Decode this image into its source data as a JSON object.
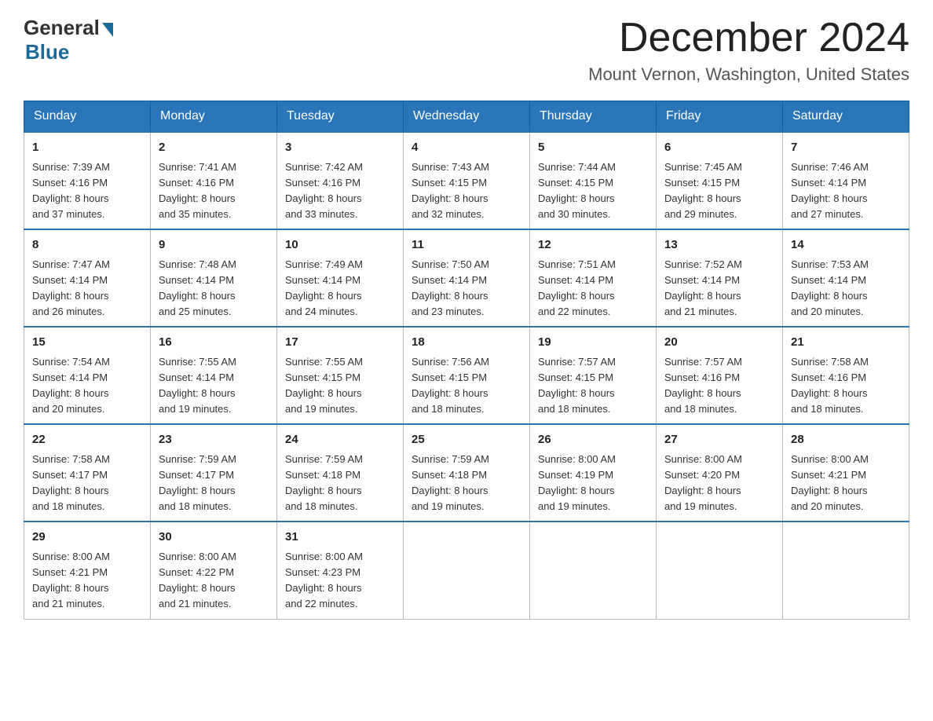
{
  "logo": {
    "general": "General",
    "blue": "Blue"
  },
  "header": {
    "month": "December 2024",
    "location": "Mount Vernon, Washington, United States"
  },
  "weekdays": [
    "Sunday",
    "Monday",
    "Tuesday",
    "Wednesday",
    "Thursday",
    "Friday",
    "Saturday"
  ],
  "weeks": [
    [
      {
        "day": "1",
        "sunrise": "7:39 AM",
        "sunset": "4:16 PM",
        "daylight": "8 hours and 37 minutes."
      },
      {
        "day": "2",
        "sunrise": "7:41 AM",
        "sunset": "4:16 PM",
        "daylight": "8 hours and 35 minutes."
      },
      {
        "day": "3",
        "sunrise": "7:42 AM",
        "sunset": "4:16 PM",
        "daylight": "8 hours and 33 minutes."
      },
      {
        "day": "4",
        "sunrise": "7:43 AM",
        "sunset": "4:15 PM",
        "daylight": "8 hours and 32 minutes."
      },
      {
        "day": "5",
        "sunrise": "7:44 AM",
        "sunset": "4:15 PM",
        "daylight": "8 hours and 30 minutes."
      },
      {
        "day": "6",
        "sunrise": "7:45 AM",
        "sunset": "4:15 PM",
        "daylight": "8 hours and 29 minutes."
      },
      {
        "day": "7",
        "sunrise": "7:46 AM",
        "sunset": "4:14 PM",
        "daylight": "8 hours and 27 minutes."
      }
    ],
    [
      {
        "day": "8",
        "sunrise": "7:47 AM",
        "sunset": "4:14 PM",
        "daylight": "8 hours and 26 minutes."
      },
      {
        "day": "9",
        "sunrise": "7:48 AM",
        "sunset": "4:14 PM",
        "daylight": "8 hours and 25 minutes."
      },
      {
        "day": "10",
        "sunrise": "7:49 AM",
        "sunset": "4:14 PM",
        "daylight": "8 hours and 24 minutes."
      },
      {
        "day": "11",
        "sunrise": "7:50 AM",
        "sunset": "4:14 PM",
        "daylight": "8 hours and 23 minutes."
      },
      {
        "day": "12",
        "sunrise": "7:51 AM",
        "sunset": "4:14 PM",
        "daylight": "8 hours and 22 minutes."
      },
      {
        "day": "13",
        "sunrise": "7:52 AM",
        "sunset": "4:14 PM",
        "daylight": "8 hours and 21 minutes."
      },
      {
        "day": "14",
        "sunrise": "7:53 AM",
        "sunset": "4:14 PM",
        "daylight": "8 hours and 20 minutes."
      }
    ],
    [
      {
        "day": "15",
        "sunrise": "7:54 AM",
        "sunset": "4:14 PM",
        "daylight": "8 hours and 20 minutes."
      },
      {
        "day": "16",
        "sunrise": "7:55 AM",
        "sunset": "4:14 PM",
        "daylight": "8 hours and 19 minutes."
      },
      {
        "day": "17",
        "sunrise": "7:55 AM",
        "sunset": "4:15 PM",
        "daylight": "8 hours and 19 minutes."
      },
      {
        "day": "18",
        "sunrise": "7:56 AM",
        "sunset": "4:15 PM",
        "daylight": "8 hours and 18 minutes."
      },
      {
        "day": "19",
        "sunrise": "7:57 AM",
        "sunset": "4:15 PM",
        "daylight": "8 hours and 18 minutes."
      },
      {
        "day": "20",
        "sunrise": "7:57 AM",
        "sunset": "4:16 PM",
        "daylight": "8 hours and 18 minutes."
      },
      {
        "day": "21",
        "sunrise": "7:58 AM",
        "sunset": "4:16 PM",
        "daylight": "8 hours and 18 minutes."
      }
    ],
    [
      {
        "day": "22",
        "sunrise": "7:58 AM",
        "sunset": "4:17 PM",
        "daylight": "8 hours and 18 minutes."
      },
      {
        "day": "23",
        "sunrise": "7:59 AM",
        "sunset": "4:17 PM",
        "daylight": "8 hours and 18 minutes."
      },
      {
        "day": "24",
        "sunrise": "7:59 AM",
        "sunset": "4:18 PM",
        "daylight": "8 hours and 18 minutes."
      },
      {
        "day": "25",
        "sunrise": "7:59 AM",
        "sunset": "4:18 PM",
        "daylight": "8 hours and 19 minutes."
      },
      {
        "day": "26",
        "sunrise": "8:00 AM",
        "sunset": "4:19 PM",
        "daylight": "8 hours and 19 minutes."
      },
      {
        "day": "27",
        "sunrise": "8:00 AM",
        "sunset": "4:20 PM",
        "daylight": "8 hours and 19 minutes."
      },
      {
        "day": "28",
        "sunrise": "8:00 AM",
        "sunset": "4:21 PM",
        "daylight": "8 hours and 20 minutes."
      }
    ],
    [
      {
        "day": "29",
        "sunrise": "8:00 AM",
        "sunset": "4:21 PM",
        "daylight": "8 hours and 21 minutes."
      },
      {
        "day": "30",
        "sunrise": "8:00 AM",
        "sunset": "4:22 PM",
        "daylight": "8 hours and 21 minutes."
      },
      {
        "day": "31",
        "sunrise": "8:00 AM",
        "sunset": "4:23 PM",
        "daylight": "8 hours and 22 minutes."
      },
      null,
      null,
      null,
      null
    ]
  ],
  "labels": {
    "sunrise": "Sunrise:",
    "sunset": "Sunset:",
    "daylight": "Daylight:"
  }
}
